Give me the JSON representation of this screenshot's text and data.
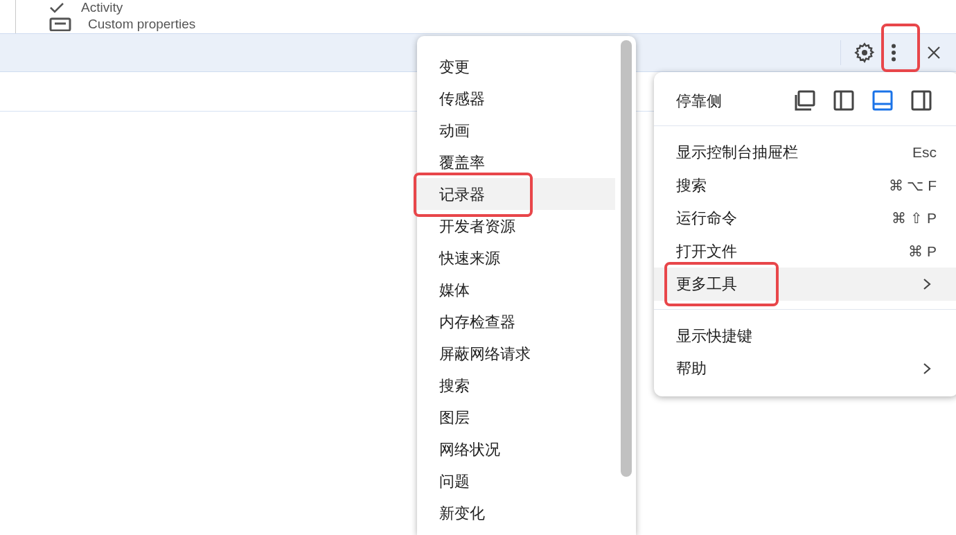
{
  "background_panel": {
    "items": [
      {
        "label": "Activity"
      },
      {
        "label": "Custom properties"
      }
    ]
  },
  "more_tools_submenu": {
    "items": [
      {
        "label": "变更",
        "selected": false
      },
      {
        "label": "传感器",
        "selected": false
      },
      {
        "label": "动画",
        "selected": false
      },
      {
        "label": "覆盖率",
        "selected": false
      },
      {
        "label": "记录器",
        "selected": true
      },
      {
        "label": "开发者资源",
        "selected": false
      },
      {
        "label": "快速来源",
        "selected": false
      },
      {
        "label": "媒体",
        "selected": false
      },
      {
        "label": "内存检查器",
        "selected": false
      },
      {
        "label": "屏蔽网络请求",
        "selected": false
      },
      {
        "label": "搜索",
        "selected": false
      },
      {
        "label": "图层",
        "selected": false
      },
      {
        "label": "网络状况",
        "selected": false
      },
      {
        "label": "问题",
        "selected": false
      },
      {
        "label": "新变化",
        "selected": false
      }
    ]
  },
  "main_menu": {
    "dock_side": {
      "label": "停靠侧",
      "options": [
        {
          "kind": "undock",
          "selected": false
        },
        {
          "kind": "left",
          "selected": false
        },
        {
          "kind": "bottom",
          "selected": true
        },
        {
          "kind": "right",
          "selected": false
        }
      ]
    },
    "sections": [
      [
        {
          "label": "显示控制台抽屉栏",
          "shortcut": "Esc",
          "selected": false,
          "submenu": false
        },
        {
          "label": "搜索",
          "shortcut": "⌘ ⌥ F",
          "selected": false,
          "submenu": false
        },
        {
          "label": "运行命令",
          "shortcut": "⌘ ⇧ P",
          "selected": false,
          "submenu": false
        },
        {
          "label": "打开文件",
          "shortcut": "⌘ P",
          "selected": false,
          "submenu": false
        },
        {
          "label": "更多工具",
          "selected": true,
          "submenu": true
        }
      ],
      [
        {
          "label": "显示快捷键",
          "selected": false,
          "submenu": false
        },
        {
          "label": "帮助",
          "selected": false,
          "submenu": true
        }
      ]
    ]
  }
}
